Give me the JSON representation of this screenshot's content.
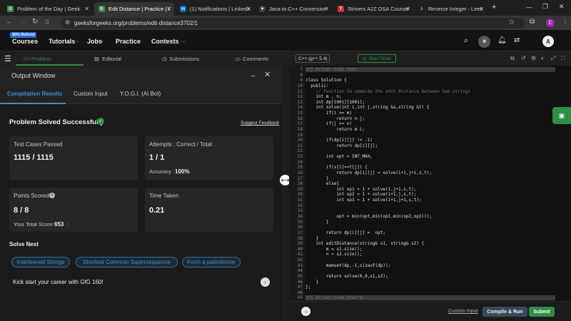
{
  "browser": {
    "tabs": [
      {
        "title": "Problem of the Day | Geek",
        "icon": "gfg-icon",
        "color": "#2f8d46"
      },
      {
        "title": "Edit Distance | Practice | G",
        "icon": "gfg-icon",
        "color": "#2f8d46"
      },
      {
        "title": "(1) Notifications | LinkedIn",
        "icon": "linkedin-icon",
        "color": "#0a66c2"
      },
      {
        "title": "Java to C++ Conversion",
        "icon": "chatgpt-icon",
        "color": "#cccccc"
      },
      {
        "title": "Strivers A2Z DSA Course/Sh",
        "icon": "tuf-icon",
        "color": "#d32f2f"
      },
      {
        "title": "Reverse Integer - LeetCod",
        "icon": "leetcode-icon",
        "color": "#f89f1b"
      }
    ],
    "url": "geeksforgeeks.org/problems/edit-distance3702/1",
    "profile_initial": "C"
  },
  "site": {
    "badge": "90% Refund",
    "nav": [
      "Courses",
      "Tutorials",
      "Jobs",
      "Practice",
      "Contests"
    ],
    "avatar": "A"
  },
  "left": {
    "tabs": [
      "Problem",
      "Editorial",
      "Submissions",
      "Comments"
    ],
    "output_title": "Output Window",
    "subtabs": [
      "Compilation Results",
      "Custom Input",
      "Y.O.G.I. (AI Bot)"
    ],
    "status": "Problem Solved Successfully",
    "suggest": "Suggest Feedback",
    "tests_label": "Test Cases Passed",
    "tests_value": "1115 / 1115",
    "attempts_label": "Attempts : Correct / Total",
    "attempts_value": "1 / 1",
    "accuracy_label": "Accuracy :",
    "accuracy_value": "100%",
    "points_label": "Points Scored",
    "points_value": "8 / 8",
    "total_label": "Your Total Score:",
    "total_value": "653",
    "time_label": "Time Taken",
    "time_value": "0.21",
    "solve_next": "Solve Next",
    "chips": [
      "Interleaved Strings",
      "Shortest Common Supersequence",
      "Form a palindrome"
    ],
    "kick": "Kick start your career with GfG 160!"
  },
  "editor": {
    "language": "C++ (g++ 5.4)",
    "timer": "Start Timer",
    "custom_input": "Custom Input",
    "compile": "Compile & Run",
    "submit": "Submit",
    "lines": [
      "//} Driver Code Ends",
      "",
      "class Solution {",
      "  public:",
      "    // Function to compute the edit distance between two strings",
      "    int m , n;",
      "    int dp[1001][1001];",
      "    int solve(int i,int j,string &s,string &t) {",
      "        if(i >= m)",
      "            return n-j;",
      "        if(j >= n)",
      "            return m-i;",
      "",
      "        if(dp[i][j] != -1)",
      "            return dp[i][j];",
      "",
      "        int opt = INT_MAX;",
      "",
      "        if(s[i]==t[j]) {",
      "            return dp[i][j] = solve(i+1,j+1,s,t);",
      "        }",
      "        else{",
      "            int op1 = 1 + solve(i,j+1,s,t);",
      "            int op2 = 1 + solve(i+1,j,s,t);",
      "            int op3 = 1 + solve(i+1,j+1,s,t);",
      "",
      "",
      "            opt = min(opt,min(op1,min(op2,op3)));",
      "        }",
      "",
      "        return dp[i][j] =  opt;",
      "    }",
      "    int editDistance(string& s1, string& s2) {",
      "        m = s1.size();",
      "        n = s2.size();",
      "",
      "        memset(dp,-1,sizeof(dp));",
      "",
      "        return solve(0,0,s1,s2);",
      "    }",
      "};",
      "",
      "//{ Driver Code Starts."
    ]
  },
  "colors": {
    "accent_green": "#2f8d46",
    "link_blue": "#3d8ed0"
  }
}
